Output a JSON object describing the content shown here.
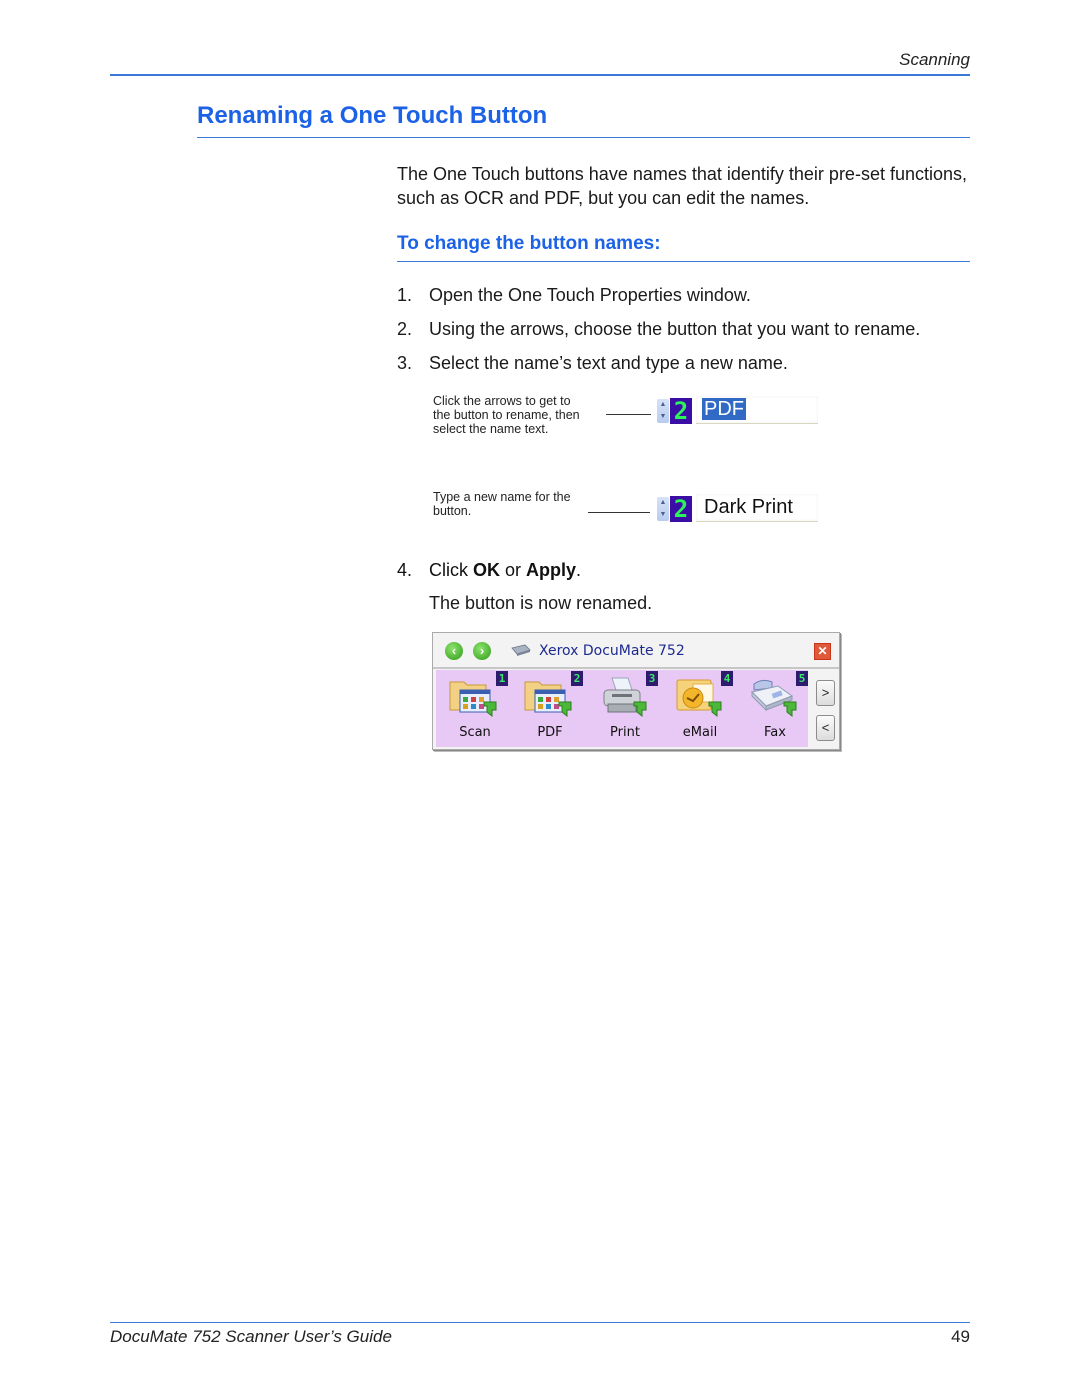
{
  "header": {
    "section_label": "Scanning"
  },
  "section": {
    "title": "Renaming a One Touch Button"
  },
  "intro": "The One Touch buttons have names that identify their pre-set functions, such as OCR and PDF, but you can edit the names.",
  "procedure": {
    "title": "To change the button names:",
    "steps": [
      {
        "num": "1.",
        "text": "Open the One Touch Properties window."
      },
      {
        "num": "2.",
        "text": "Using the arrows, choose the button that you want to rename."
      },
      {
        "num": "3.",
        "text": "Select the name’s text and type a new name."
      }
    ],
    "step4": {
      "num": "4.",
      "pre": "Click ",
      "ok": "OK",
      "mid": " or ",
      "apply": "Apply",
      "post": "."
    },
    "result": "The button is now renamed."
  },
  "figures": {
    "select_callout": {
      "lines": [
        "Click the arrows to get to",
        "the button to rename, then",
        "select the name text."
      ],
      "button_number": "2",
      "name_value": "PDF",
      "selected": true
    },
    "type_callout": {
      "lines": [
        "Type a new name for the",
        "button."
      ],
      "button_number": "2",
      "name_value": "Dark Print",
      "selected": false
    }
  },
  "one_touch_panel": {
    "title": "Xerox DocuMate 752",
    "back_icon": "back-arrow-icon",
    "forward_icon": "forward-arrow-icon",
    "close_label": "✕",
    "next_label": ">",
    "prev_label": "<",
    "buttons": [
      {
        "number": "1",
        "label": "Scan",
        "icon": "folder-documents-icon"
      },
      {
        "number": "2",
        "label": "PDF",
        "icon": "folder-documents-icon"
      },
      {
        "number": "3",
        "label": "Print",
        "icon": "printer-icon"
      },
      {
        "number": "4",
        "label": "eMail",
        "icon": "email-icon"
      },
      {
        "number": "5",
        "label": "Fax",
        "icon": "fax-icon"
      }
    ]
  },
  "footer": {
    "guide_title": "DocuMate 752 Scanner User’s Guide",
    "page_number": "49"
  }
}
